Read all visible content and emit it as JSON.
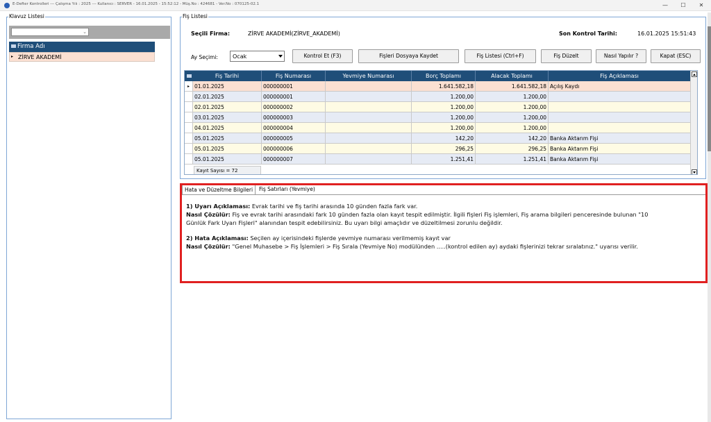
{
  "window": {
    "title": "E-Defter Kontrolleri  ---  Çalışma Yılı : 2025  ---  Kullanıcı : SERVER - 16.01.2025 - 15:52:12 - Müş.No : 424681 - Ver.No : 070125-02.1",
    "minimize_glyph": "—",
    "maximize_glyph": "☐",
    "close_glyph": "✕"
  },
  "left_panel": {
    "title": "Klavuz Listesi",
    "filter_value": "",
    "column_header": "Firma Adı",
    "rows": [
      {
        "indicator": "▸",
        "name": "ZİRVE AKADEMİ"
      }
    ]
  },
  "fis_panel": {
    "title": "Fiş Listesi",
    "secili_firma_label": "Seçili Firma:",
    "secili_firma_value": "ZİRVE AKADEMİ(ZİRVE_AKADEMİ)",
    "son_kontrol_label": "Son Kontrol Tarihi:",
    "son_kontrol_value": "16.01.2025 15:51:43",
    "ay_secimi_label": "Ay Seçimi:",
    "ay_secimi_value": "Ocak",
    "buttons": {
      "kontrol_et": "Kontrol Et (F3)",
      "kaydet": "Fişleri Dosyaya Kaydet",
      "fis_listesi": "Fiş Listesi (Ctrl+F)",
      "fis_duzelt": "Fiş Düzelt",
      "nasil_yapilir": "Nasıl Yapılır ?",
      "kapat": "Kapat (ESC)"
    },
    "columns": [
      "Fiş Tarihi",
      "Fiş Numarası",
      "Yevmiye Numarası",
      "Borç Toplamı",
      "Alacak Toplamı",
      "Fiş Açıklaması"
    ],
    "rows": [
      {
        "tarih": "01.01.2025",
        "numara": "000000001",
        "yevmiye": "",
        "borc": "1.641.582,18",
        "alacak": "1.641.582,18",
        "aciklama": "Açılış Kaydı"
      },
      {
        "tarih": "02.01.2025",
        "numara": "000000001",
        "yevmiye": "",
        "borc": "1.200,00",
        "alacak": "1.200,00",
        "aciklama": ""
      },
      {
        "tarih": "02.01.2025",
        "numara": "000000002",
        "yevmiye": "",
        "borc": "1.200,00",
        "alacak": "1.200,00",
        "aciklama": ""
      },
      {
        "tarih": "03.01.2025",
        "numara": "000000003",
        "yevmiye": "",
        "borc": "1.200,00",
        "alacak": "1.200,00",
        "aciklama": ""
      },
      {
        "tarih": "04.01.2025",
        "numara": "000000004",
        "yevmiye": "",
        "borc": "1.200,00",
        "alacak": "1.200,00",
        "aciklama": ""
      },
      {
        "tarih": "05.01.2025",
        "numara": "000000005",
        "yevmiye": "",
        "borc": "142,20",
        "alacak": "142,20",
        "aciklama": "Banka Aktarım Fişi"
      },
      {
        "tarih": "05.01.2025",
        "numara": "000000006",
        "yevmiye": "",
        "borc": "296,25",
        "alacak": "296,25",
        "aciklama": "Banka Aktarım Fişi"
      },
      {
        "tarih": "05.01.2025",
        "numara": "000000007",
        "yevmiye": "",
        "borc": "1.251,41",
        "alacak": "1.251,41",
        "aciklama": "Banka Aktarım Fişi"
      }
    ],
    "kayit_sayisi": "Kayıt Sayısı = 72"
  },
  "tabs": [
    {
      "label": "Hata ve Düzeltme Bilgileri",
      "active": true
    },
    {
      "label": "Fiş Satırları (Yevmiye)",
      "active": false
    }
  ],
  "info": {
    "uyari_title": "1) Uyarı Açıklaması:",
    "uyari_text": " Evrak tarihi ve fiş tarihi arasında 10 günden fazla fark var.",
    "cozum1_title": "Nasıl Çözülür:",
    "cozum1_text_line1": " Fiş ve evrak tarihi arasındaki fark 10 günden fazla olan kayıt tespit edilmiştir. İlgili fişleri Fiş işlemleri, Fiş arama bilgileri penceresinde bulunan \"10",
    "cozum1_text_line2": "Günlük Fark Uyarı Fişleri\" alanından tespit edebilirsiniz. Bu uyarı bilgi amaçlıdır ve düzeltilmesi zorunlu değildir.",
    "hata_title": "2) Hata Açıklaması:",
    "hata_text": " Seçilen ay içerisindeki fişlerde yevmiye numarası verilmemiş kayıt var",
    "cozum2_title": "Nasıl Çözülür:",
    "cozum2_text": " \"Genel Muhasebe > Fiş İşlemleri > Fiş Sırala (Yevmiye No) modülünden .....(kontrol edilen ay) aydaki fişlerinizi tekrar sıralatınız.\" uyarısı verilir."
  },
  "colors": {
    "grid_header": "#1f4e79",
    "selected_row": "#fbe0d2",
    "row_alt_blue": "#e6ebf5",
    "row_alt_yellow": "#fefbe4",
    "highlight_border": "#e02020"
  }
}
